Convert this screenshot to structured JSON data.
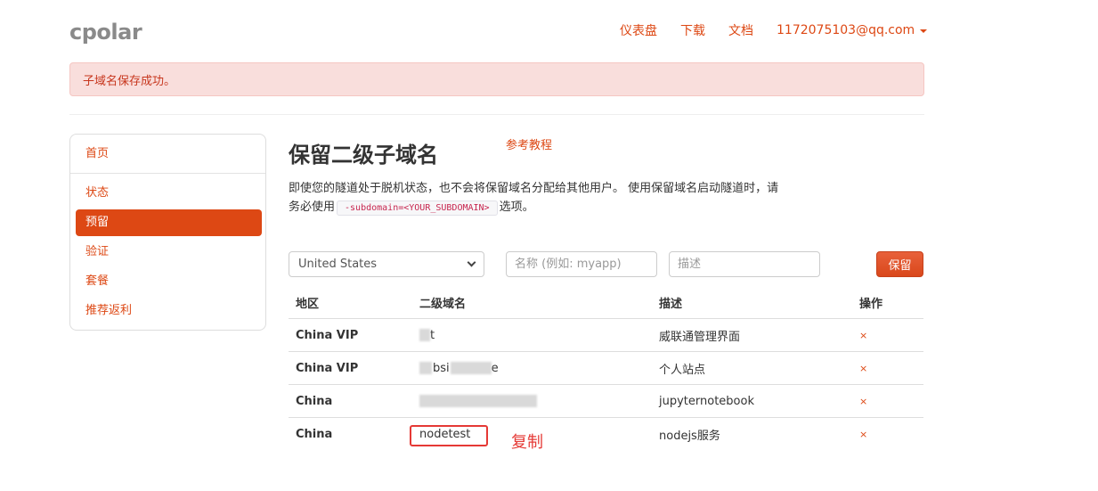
{
  "header": {
    "logo": "cpolar",
    "nav": [
      {
        "label": "仪表盘"
      },
      {
        "label": "下载"
      },
      {
        "label": "文档"
      }
    ],
    "user_email": "1172075103@qq.com"
  },
  "alert": {
    "message": "子域名保存成功。",
    "color": "#c7361d"
  },
  "sidebar": {
    "items": [
      {
        "label": "首页",
        "active": false
      },
      {
        "label": "状态",
        "active": false
      },
      {
        "label": "预留",
        "active": true
      },
      {
        "label": "验证",
        "active": false
      },
      {
        "label": "套餐",
        "active": false
      },
      {
        "label": "推荐返利",
        "active": false
      }
    ]
  },
  "main": {
    "title": "保留二级子域名",
    "tutorial_link": "参考教程",
    "description_part1": "即使您的隧道处于脱机状态，也不会将保留域名分配给其他用户。 使用保留域名启动隧道时，请务必使用",
    "description_code": "-subdomain=<YOUR_SUBDOMAIN>",
    "description_part2": "选项。",
    "form": {
      "region_selected": "United States",
      "name_placeholder": "名称 (例如: myapp)",
      "desc_placeholder": "描述",
      "submit_label": "保留"
    },
    "table": {
      "headers": [
        "地区",
        "二级域名",
        "描述",
        "操作"
      ],
      "rows": [
        {
          "region": "China VIP",
          "subdomain": "t",
          "description": "威联通管理界面",
          "action": "×"
        },
        {
          "region": "China VIP",
          "subdomain": "bsi e",
          "description": "个人站点",
          "action": "×"
        },
        {
          "region": "China",
          "subdomain": "",
          "description": "jupyternotebook",
          "action": "×"
        },
        {
          "region": "China",
          "subdomain": "nodetest",
          "description": "nodejs服务",
          "action": "×"
        }
      ]
    },
    "annotation": "复制"
  },
  "colors": {
    "accent": "#dd4814",
    "alert_bg": "#f9dedc",
    "annotation": "#e53935"
  }
}
